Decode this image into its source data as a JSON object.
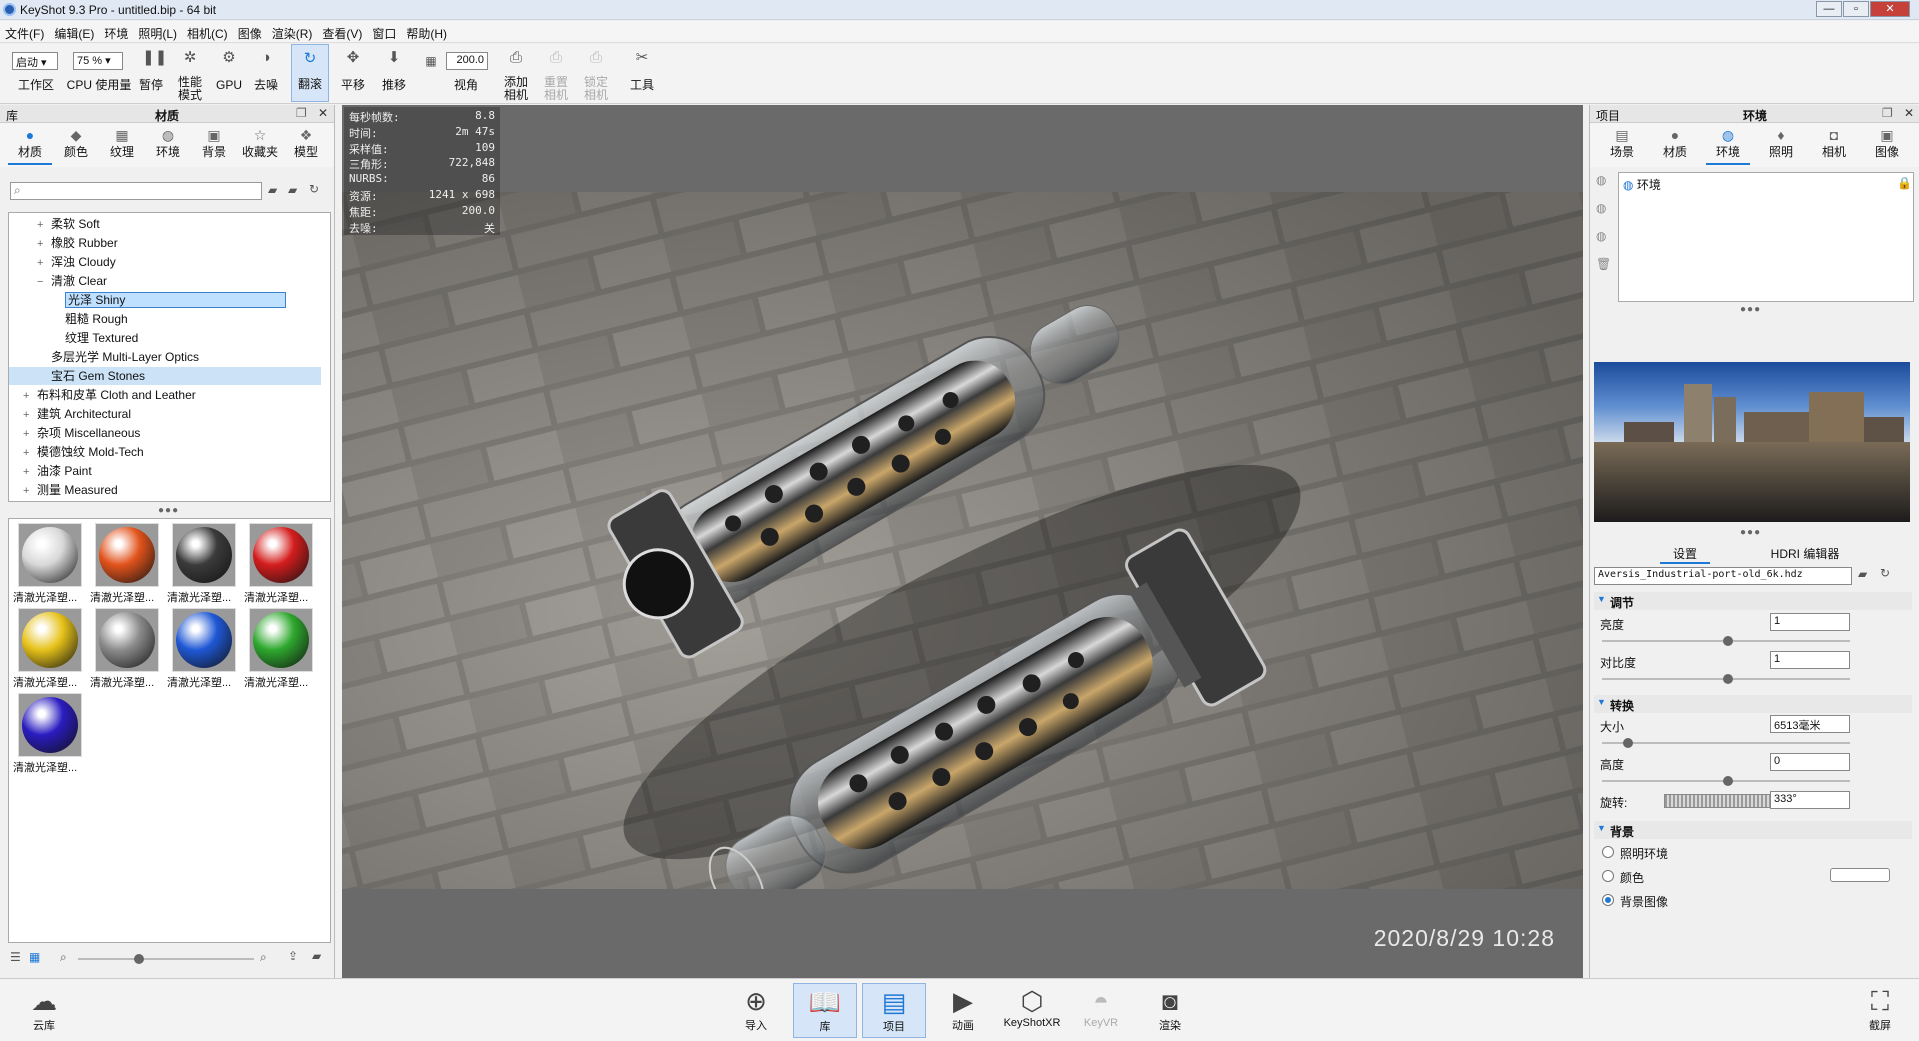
{
  "window": {
    "title": "KeyShot 9.3 Pro  - untitled.bip  - 64 bit",
    "btn_min": "—",
    "btn_max": "▫",
    "btn_close": "✕"
  },
  "menu": [
    "文件(F)",
    "编辑(E)",
    "环境",
    "照明(L)",
    "相机(C)",
    "图像",
    "渲染(R)",
    "查看(V)",
    "窗口",
    "帮助(H)"
  ],
  "toolbar": {
    "workspace_select": "启动",
    "workspace_label": "工作区",
    "cpu_select": "75 %",
    "cpu_label": "CPU 使用量",
    "pause": "暂停",
    "perf_mode": "性能\n模式",
    "gpu": "GPU",
    "denoise": "去噪",
    "tumble": "翻滚",
    "pan": "平移",
    "dolly": "推移",
    "fov_value": "200.0",
    "fov_label": "视角",
    "add_camera": "添加\n相机",
    "reset_camera": "重置\n相机",
    "lock_camera": "锁定\n相机",
    "tools": "工具"
  },
  "left_panel": {
    "header_left": "库",
    "header_title": "材质",
    "tabs": [
      "材质",
      "颜色",
      "纹理",
      "环境",
      "背景",
      "收藏夹",
      "模型"
    ],
    "search_placeholder": "",
    "tree": [
      {
        "label": "柔软 Soft",
        "indent": 1,
        "exp": "+"
      },
      {
        "label": "橡胶 Rubber",
        "indent": 1,
        "exp": "+"
      },
      {
        "label": "浑浊 Cloudy",
        "indent": 1,
        "exp": "+"
      },
      {
        "label": "清澈 Clear",
        "indent": 1,
        "exp": "−"
      },
      {
        "label": "光泽 Shiny",
        "indent": 2,
        "exp": "",
        "selected": true
      },
      {
        "label": "粗糙 Rough",
        "indent": 2,
        "exp": ""
      },
      {
        "label": "纹理 Textured",
        "indent": 2,
        "exp": ""
      },
      {
        "label": "多层光学 Multi-Layer Optics",
        "indent": 1,
        "exp": ""
      },
      {
        "label": "宝石 Gem Stones",
        "indent": 1,
        "exp": "",
        "highlight": true
      },
      {
        "label": "布料和皮革 Cloth and Leather",
        "indent": 0,
        "exp": "+"
      },
      {
        "label": "建筑 Architectural",
        "indent": 0,
        "exp": "+"
      },
      {
        "label": "杂项 Miscellaneous",
        "indent": 0,
        "exp": "+"
      },
      {
        "label": "模德蚀纹 Mold-Tech",
        "indent": 0,
        "exp": "+"
      },
      {
        "label": "油漆 Paint",
        "indent": 0,
        "exp": "+"
      },
      {
        "label": "测量 Measured",
        "indent": 0,
        "exp": "+"
      }
    ],
    "materials": [
      {
        "caption": "清澈光泽塑...",
        "color": "#d8d8d8"
      },
      {
        "caption": "清澈光泽塑...",
        "color": "#e2531c"
      },
      {
        "caption": "清澈光泽塑...",
        "color": "#3b3b3b"
      },
      {
        "caption": "清澈光泽塑...",
        "color": "#d41d1d"
      },
      {
        "caption": "清澈光泽塑...",
        "color": "#e6c21a"
      },
      {
        "caption": "清澈光泽塑...",
        "color": "#8c8c8c"
      },
      {
        "caption": "清澈光泽塑...",
        "color": "#1f58d6"
      },
      {
        "caption": "清澈光泽塑...",
        "color": "#2ea82e"
      },
      {
        "caption": "清澈光泽塑...",
        "color": "#2a1cc0"
      }
    ]
  },
  "viewport": {
    "stats": [
      {
        "k": "每秒帧数:",
        "v": "8.8"
      },
      {
        "k": "时间:",
        "v": "2m 47s"
      },
      {
        "k": "采样值:",
        "v": "109"
      },
      {
        "k": "三角形:",
        "v": "722,848"
      },
      {
        "k": "NURBS:",
        "v": "86"
      },
      {
        "k": "资源:",
        "v": "1241 x 698"
      },
      {
        "k": "焦距:",
        "v": "200.0"
      },
      {
        "k": "去噪:",
        "v": "关"
      }
    ],
    "timestamp": "2020/8/29  10:28"
  },
  "right_panel": {
    "header_left": "项目",
    "header_title": "环境",
    "tabs": [
      "场景",
      "材质",
      "环境",
      "照明",
      "相机",
      "图像"
    ],
    "env_item": "环境",
    "subtab_settings": "设置",
    "subtab_hdri": "HDRI 编辑器",
    "hdri_file": "Aversis_Industrial-port-old_6k.hdz",
    "section_adjust": "调节",
    "brightness_label": "亮度",
    "brightness_value": "1",
    "contrast_label": "对比度",
    "contrast_value": "1",
    "section_transform": "转换",
    "size_label": "大小",
    "size_value": "6513毫米",
    "height_label": "高度",
    "height_value": "0",
    "rotation_label": "旋转:",
    "rotation_value": "333°",
    "section_background": "背景",
    "bg_options": [
      "照明环境",
      "颜色",
      "背景图像"
    ],
    "bg_selected": 2
  },
  "bottom_bar": {
    "cloud": "云库",
    "import": "导入",
    "library": "库",
    "project": "项目",
    "animation": "动画",
    "keyshotxr": "KeyShotXR",
    "keyvr": "KeyVR",
    "render": "渲染",
    "screenshot": "截屏"
  }
}
